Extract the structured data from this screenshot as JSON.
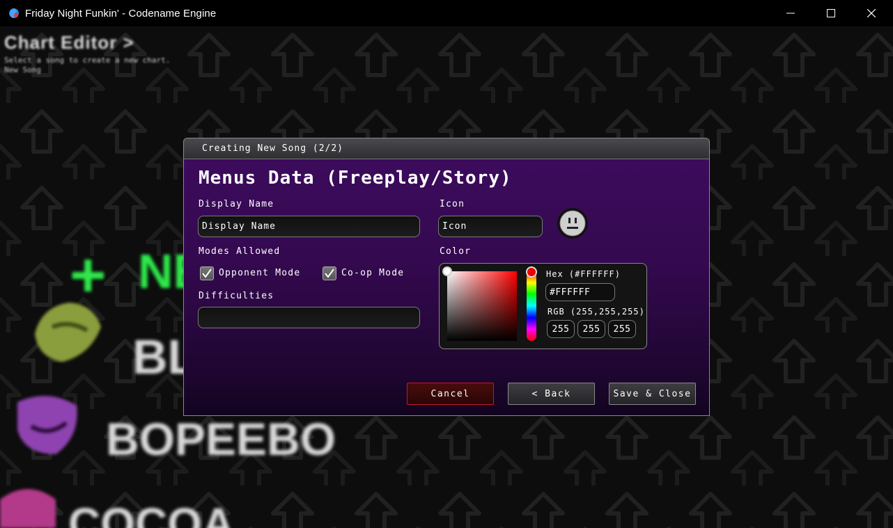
{
  "window": {
    "title": "Friday Night Funkin' - Codename Engine",
    "controls": [
      "minimize-icon",
      "maximize-icon",
      "close-icon"
    ]
  },
  "background": {
    "editor_title": "Chart Editor >",
    "editor_subtitle_lines": [
      "Select a song to create a new chart.",
      "New Song"
    ],
    "song_list": [
      "NE",
      "BL",
      "BOPEEBO",
      "COCOA"
    ],
    "accent_colors": {
      "new_song": "#2ee84a",
      "pattern": "#2a2a2a"
    }
  },
  "dialog": {
    "header": "Creating New Song (2/2)",
    "heading": "Menus Data (Freeplay/Story)",
    "display_name": {
      "label": "Display Name",
      "value": "Display Name"
    },
    "icon": {
      "label": "Icon",
      "value": "Icon",
      "preview_icon": "face-icon"
    },
    "modes": {
      "label": "Modes Allowed",
      "opponent": {
        "label": "Opponent Mode",
        "checked": true
      },
      "coop": {
        "label": "Co-op Mode",
        "checked": true
      }
    },
    "difficulties": {
      "label": "Difficulties",
      "value": ""
    },
    "color": {
      "label": "Color",
      "hex_label": "Hex (#FFFFFF)",
      "hex_value": "#FFFFFF",
      "rgb_label": "RGB (255,255,255)",
      "r": "255",
      "g": "255",
      "b": "255"
    },
    "buttons": {
      "cancel": "Cancel",
      "back": "< Back",
      "save": "Save & Close"
    },
    "colors": {
      "panel": "#3e0c5f",
      "cancel_border": "#c4162a"
    }
  }
}
